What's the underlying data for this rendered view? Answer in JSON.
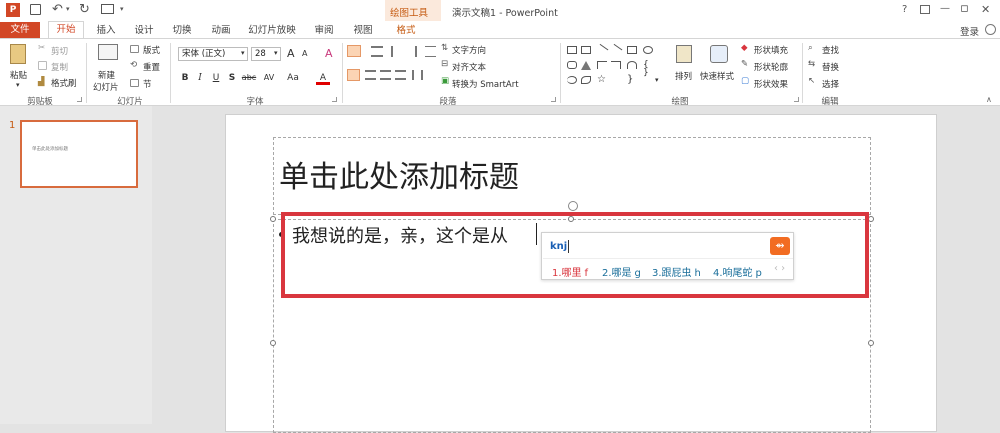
{
  "window": {
    "title": "演示文稿1 - PowerPoint",
    "help": "?",
    "login": "登录",
    "minimize": "—",
    "maximize": "▫",
    "close": "✕"
  },
  "contextual": {
    "group": "绘图工具",
    "tab": "格式"
  },
  "tabs": [
    "文件",
    "开始",
    "插入",
    "设计",
    "切换",
    "动画",
    "幻灯片放映",
    "审阅",
    "视图"
  ],
  "clipboard": {
    "paste": "粘贴",
    "cut": "剪切",
    "copy": "复制",
    "format_painter": "格式刷",
    "label": "剪贴板"
  },
  "slides": {
    "new_slide": "新建",
    "new_slide2": "幻灯片",
    "layout": "版式",
    "reset": "重置",
    "section": "节",
    "label": "幻灯片"
  },
  "font": {
    "name": "宋体 (正文)",
    "size": "28",
    "label": "字体",
    "bold": "B",
    "italic": "I",
    "underline": "U",
    "shadow": "S",
    "strike": "abc",
    "spacing": "AV",
    "case": "Aa",
    "color": "A",
    "grow": "A",
    "shrink": "A",
    "clear": "A"
  },
  "paragraph": {
    "text_direction": "文字方向",
    "align_text": "对齐文本",
    "smartart": "转换为 SmartArt",
    "label": "段落"
  },
  "drawing": {
    "arrange": "排列",
    "quick_styles": "快速样式",
    "fill": "形状填充",
    "outline": "形状轮廓",
    "effects": "形状效果",
    "label": "绘图"
  },
  "editing": {
    "find": "查找",
    "replace": "替换",
    "select": "选择",
    "label": "编辑"
  },
  "thumbnail": {
    "number": "1",
    "text": "单击此处添加标题"
  },
  "slide": {
    "title": "单击此处添加标题",
    "body": "我想说的是，亲，这个是从"
  },
  "ime": {
    "input": "knj",
    "candidates": [
      {
        "idx": "1.",
        "word": "哪里",
        "letter": "f"
      },
      {
        "idx": "2.",
        "word": "哪是",
        "letter": "g"
      },
      {
        "idx": "3.",
        "word": "跟屁虫",
        "letter": "h"
      },
      {
        "idx": "4.",
        "word": "响尾蛇",
        "letter": "p"
      }
    ],
    "nav": "‹ ›"
  },
  "colors": {
    "accent": "#d24726",
    "highlight": "#d9363e",
    "ime_logo": "#f26c22"
  }
}
